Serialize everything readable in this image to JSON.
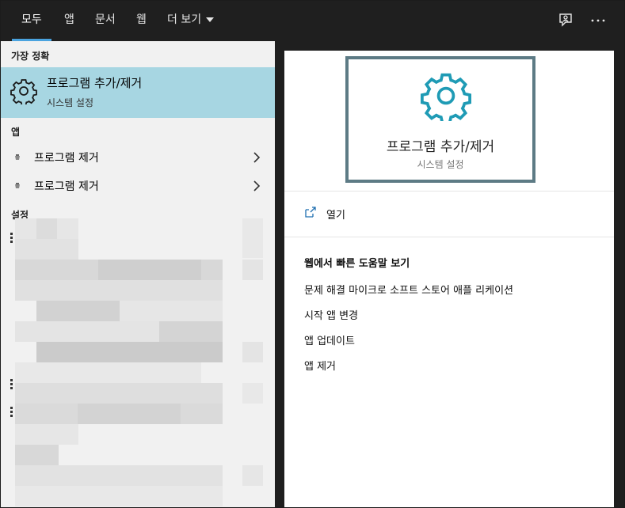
{
  "tabs": [
    {
      "label": "모두",
      "active": true
    },
    {
      "label": "앱"
    },
    {
      "label": "문서"
    },
    {
      "label": "웹"
    },
    {
      "label": "더 보기"
    }
  ],
  "topbar_icons": [
    "feedback-icon",
    "more-options-icon"
  ],
  "left": {
    "best_match_header": "가장 정확",
    "best_match": {
      "title": "프로그램 추가/제거",
      "subtitle": "시스템 설정"
    },
    "apps_header": "앱",
    "apps": [
      {
        "label": "프로그램 제거"
      },
      {
        "label": "프로그램 제거"
      }
    ],
    "settings_header": "설정"
  },
  "right": {
    "preview": {
      "title": "프로그램 추가/제거",
      "subtitle": "시스템 설정"
    },
    "open_label": "열기",
    "web_header": "웹에서 빠른 도움말 보기",
    "web_links": [
      "문제 해결 마이크로 소프트 스토어 애플 리케이션",
      "시작 앱 변경",
      "앱 업데이트",
      "앱 제거"
    ]
  },
  "colors": {
    "accent": "#4aa3df",
    "selected_bg": "#a7d6e2",
    "gear_teal": "#1f9bb5",
    "card_border": "#5d7b85",
    "topbar_bg": "#1f1f1f"
  }
}
